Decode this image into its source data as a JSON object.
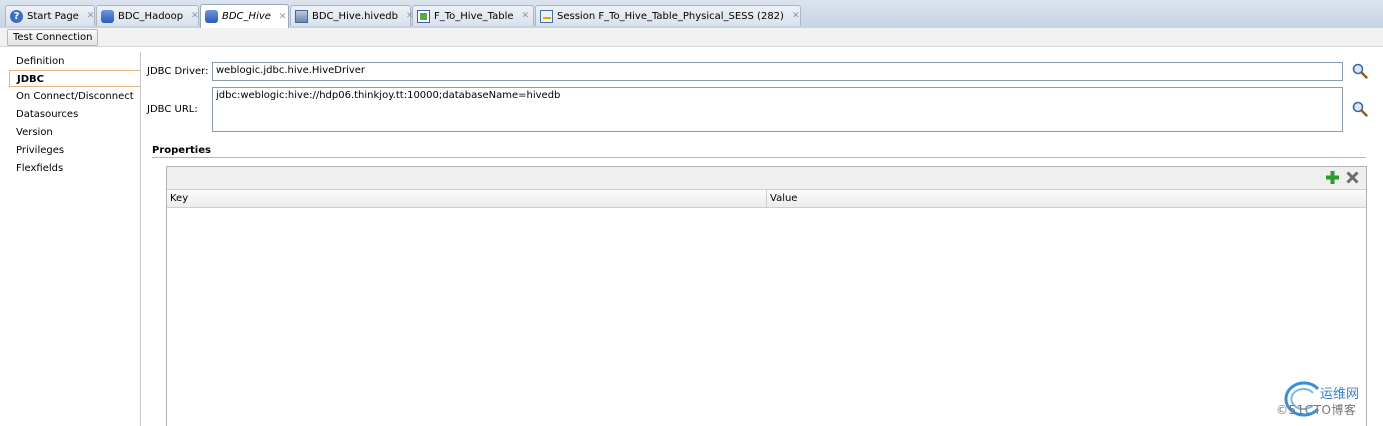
{
  "tabs": [
    {
      "label": "Start Page",
      "icon": "help-icon",
      "active": false
    },
    {
      "label": "BDC_Hadoop",
      "icon": "database-icon",
      "active": false
    },
    {
      "label": "BDC_Hive",
      "icon": "database-icon",
      "active": true
    },
    {
      "label": "BDC_Hive.hivedb",
      "icon": "model-icon",
      "active": false
    },
    {
      "label": "F_To_Hive_Table",
      "icon": "mapping-icon",
      "active": false
    },
    {
      "label": "Session F_To_Hive_Table_Physical_SESS (282)",
      "icon": "session-icon",
      "active": false
    }
  ],
  "toolbar": {
    "test_connection_label": "Test Connection"
  },
  "nav": {
    "items": [
      {
        "label": "Definition"
      },
      {
        "label": "JDBC",
        "selected": true
      },
      {
        "label": "On Connect/Disconnect"
      },
      {
        "label": "Datasources"
      },
      {
        "label": "Version"
      },
      {
        "label": "Privileges"
      },
      {
        "label": "Flexfields"
      }
    ]
  },
  "jdbc": {
    "driver_label": "JDBC Driver:",
    "driver_value": "weblogic.jdbc.hive.HiveDriver",
    "url_label": "JDBC URL:",
    "url_value": "jdbc:weblogic:hive://hdp06.thinkjoy.tt:10000;databaseName=hivedb"
  },
  "properties": {
    "title": "Properties",
    "columns": [
      "Key",
      "Value"
    ],
    "rows": []
  },
  "watermark": {
    "top": "运维网",
    "bottom": "©51CTO博客"
  },
  "colors": {
    "tab_bar": "#c8d3e2",
    "nav_selected_border": "#e7b282",
    "add_green": "#2e9b2e",
    "delete_gray": "#6d6d6d"
  }
}
